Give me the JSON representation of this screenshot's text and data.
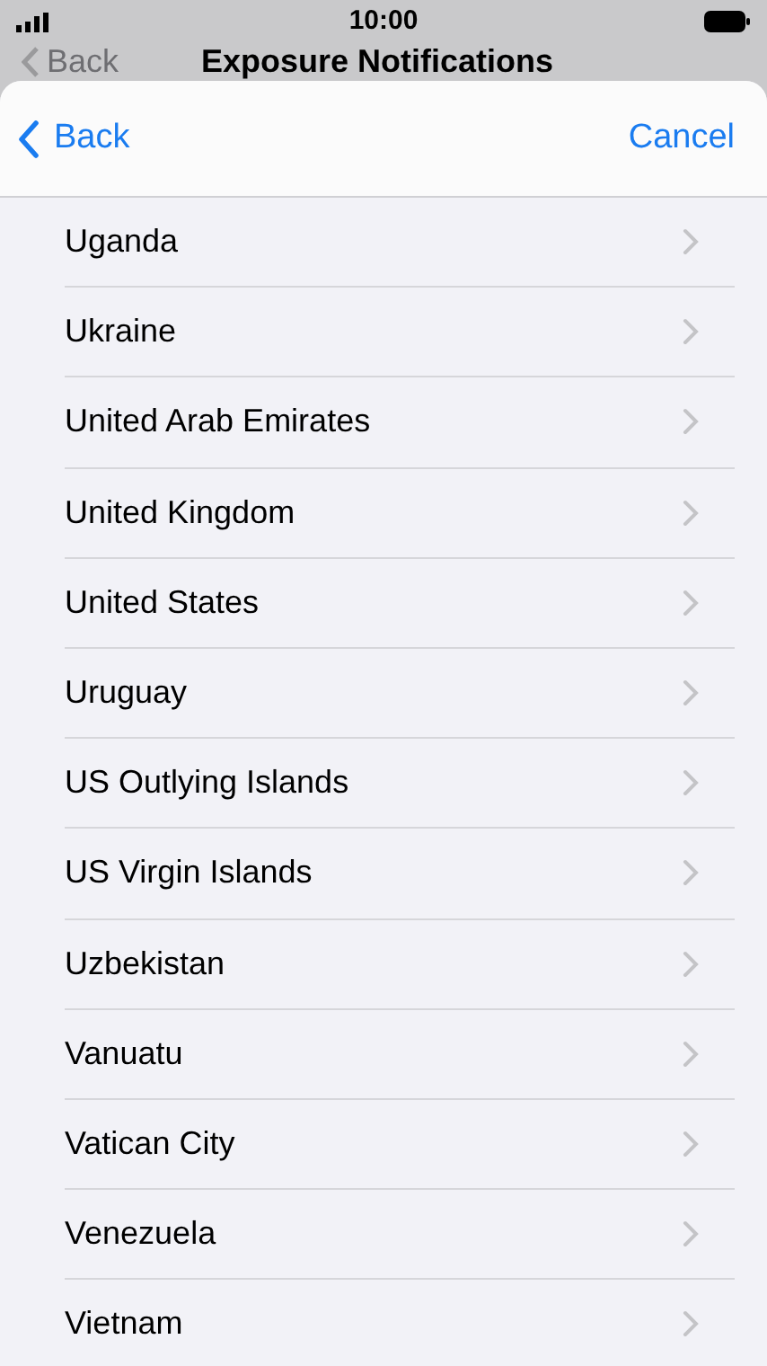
{
  "status_bar": {
    "time": "10:00"
  },
  "background_nav": {
    "back": "Back",
    "title": "Exposure Notifications"
  },
  "sheet": {
    "back": "Back",
    "cancel": "Cancel"
  },
  "countries": [
    {
      "name": "Uganda"
    },
    {
      "name": "Ukraine"
    },
    {
      "name": "United Arab Emirates"
    },
    {
      "name": "United Kingdom"
    },
    {
      "name": "United States"
    },
    {
      "name": "Uruguay"
    },
    {
      "name": "US Outlying Islands"
    },
    {
      "name": "US Virgin Islands"
    },
    {
      "name": "Uzbekistan"
    },
    {
      "name": "Vanuatu"
    },
    {
      "name": "Vatican City"
    },
    {
      "name": "Venezuela"
    },
    {
      "name": "Vietnam"
    }
  ]
}
